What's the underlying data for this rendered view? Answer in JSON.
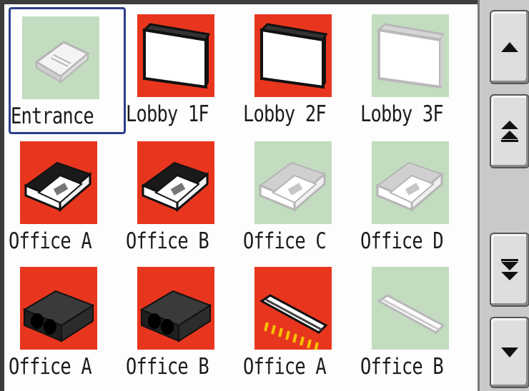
{
  "tiles": [
    {
      "label": "Entrance",
      "state": "off",
      "icon": "cassette-ac-icon",
      "selected": true
    },
    {
      "label": "Lobby 1F",
      "state": "on",
      "icon": "floor-standing-ac-icon",
      "selected": false
    },
    {
      "label": "Lobby 2F",
      "state": "on",
      "icon": "floor-standing-ac-icon",
      "selected": false
    },
    {
      "label": "Lobby 3F",
      "state": "off",
      "icon": "floor-standing-ac-icon",
      "selected": false
    },
    {
      "label": "Office A",
      "state": "on",
      "icon": "ceiling-cassette-ac-icon",
      "selected": false
    },
    {
      "label": "Office B",
      "state": "on",
      "icon": "ceiling-cassette-ac-icon",
      "selected": false
    },
    {
      "label": "Office C",
      "state": "off",
      "icon": "ceiling-cassette-ac-icon",
      "selected": false
    },
    {
      "label": "Office D",
      "state": "off",
      "icon": "ceiling-cassette-ac-icon",
      "selected": false
    },
    {
      "label": "Office A",
      "state": "on",
      "icon": "ducted-ac-icon",
      "selected": false
    },
    {
      "label": "Office B",
      "state": "on",
      "icon": "ducted-ac-icon",
      "selected": false
    },
    {
      "label": "Office A",
      "state": "on",
      "icon": "ceiling-light-icon",
      "selected": false
    },
    {
      "label": "Office B",
      "state": "off",
      "icon": "ceiling-light-icon",
      "selected": false
    }
  ],
  "scroll_buttons": [
    {
      "name": "scroll-up-button",
      "icon": "up-arrow-icon"
    },
    {
      "name": "scroll-page-up-button",
      "icon": "double-up-arrow-icon"
    },
    {
      "name": "scroll-page-down-button",
      "icon": "double-down-arrow-icon"
    },
    {
      "name": "scroll-down-button",
      "icon": "down-arrow-icon"
    }
  ],
  "colors": {
    "on_background": "#e8361e",
    "off_background": "#c3dcc0",
    "selection_border": "#2c3e8a"
  }
}
